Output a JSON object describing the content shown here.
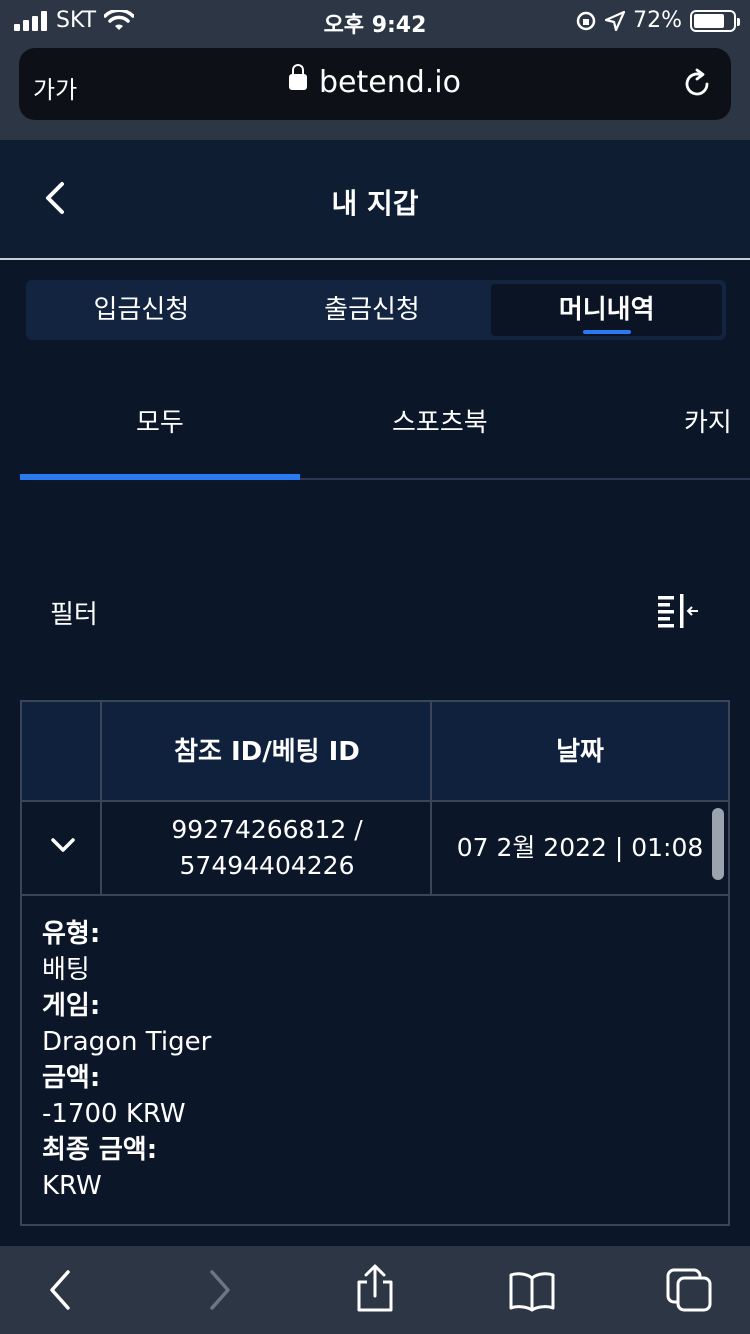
{
  "status": {
    "carrier": "SKT",
    "time": "오후 9:42",
    "battery": "72%",
    "battery_level": 0.72
  },
  "browser": {
    "text_size": "가가",
    "url": "betend.io"
  },
  "header": {
    "title": "내 지갑"
  },
  "segments": [
    {
      "label": "입금신청"
    },
    {
      "label": "출금신청"
    },
    {
      "label": "머니내역"
    }
  ],
  "subtabs": [
    {
      "label": "모두"
    },
    {
      "label": "스포츠북"
    },
    {
      "label": "카지"
    }
  ],
  "filter": {
    "label": "필터"
  },
  "table": {
    "columns": [
      "",
      "참조 ID/베팅 ID",
      "날짜"
    ],
    "row": {
      "ref_id": "99274266812 /",
      "bet_id": "57494404226",
      "date": "07 2월 2022 | 01:08"
    },
    "details": {
      "type_label": "유형:",
      "type_value": "배팅",
      "game_label": "게임:",
      "game_value": "Dragon Tiger",
      "amount_label": "금액:",
      "amount_value": "-1700 KRW",
      "final_label": "최종 금액:",
      "final_value": "KRW"
    }
  },
  "colors": {
    "accent": "#2b79f0",
    "background": "#0b1628",
    "header": "#0f1d33"
  },
  "icons": [
    "signal-icon",
    "wifi-icon",
    "lock-icon",
    "reload-icon",
    "back-icon",
    "filter-icon",
    "chevron-down-icon",
    "nav-back-icon",
    "nav-forward-icon",
    "share-icon",
    "bookmarks-icon",
    "tabs-icon"
  ]
}
